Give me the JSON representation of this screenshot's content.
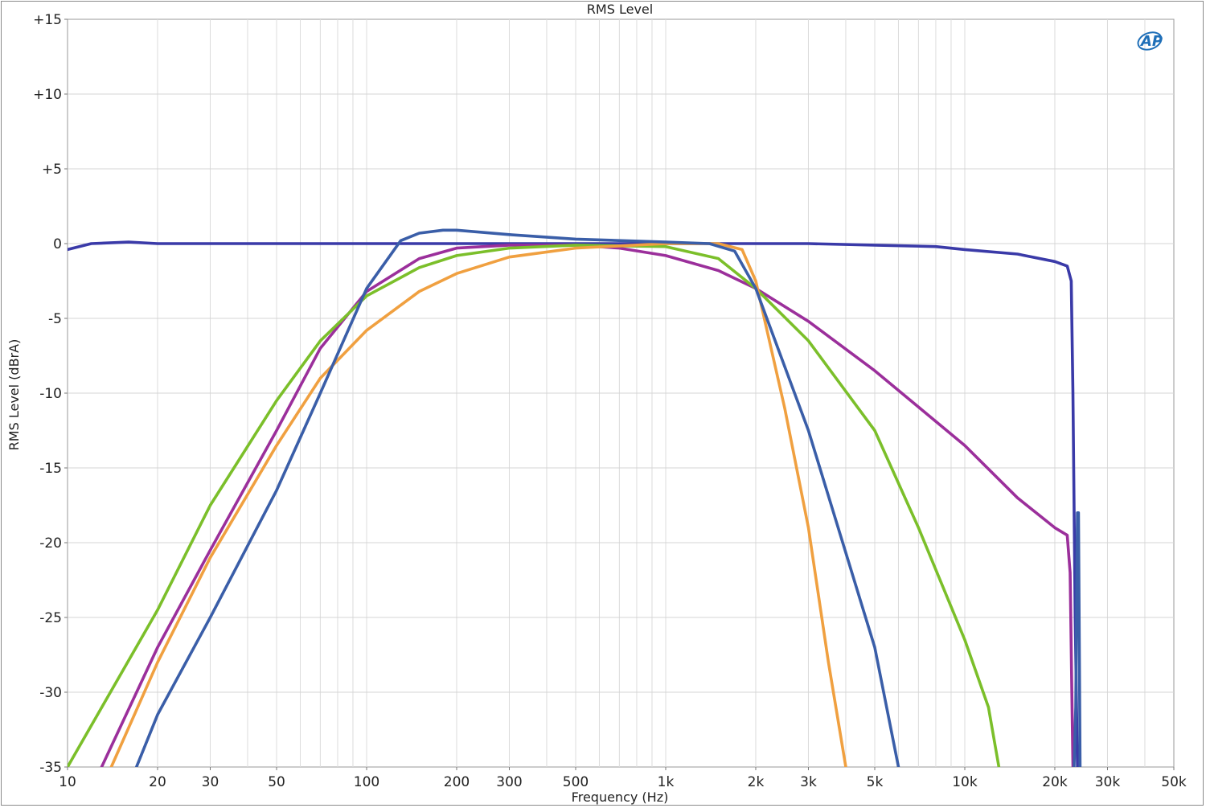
{
  "chart_data": {
    "type": "line",
    "title": "RMS Level",
    "xlabel": "Frequency (Hz)",
    "ylabel": "RMS Level (dBrA)",
    "x_scale": "log",
    "xlim": [
      10,
      50000
    ],
    "ylim": [
      -35,
      15
    ],
    "grid": true,
    "logo": "AP",
    "x_ticks": [
      {
        "v": 10,
        "label": "10"
      },
      {
        "v": 20,
        "label": "20"
      },
      {
        "v": 30,
        "label": "30"
      },
      {
        "v": 50,
        "label": "50"
      },
      {
        "v": 100,
        "label": "100"
      },
      {
        "v": 200,
        "label": "200"
      },
      {
        "v": 300,
        "label": "300"
      },
      {
        "v": 500,
        "label": "500"
      },
      {
        "v": 1000,
        "label": "1k"
      },
      {
        "v": 2000,
        "label": "2k"
      },
      {
        "v": 3000,
        "label": "3k"
      },
      {
        "v": 5000,
        "label": "5k"
      },
      {
        "v": 10000,
        "label": "10k"
      },
      {
        "v": 20000,
        "label": "20k"
      },
      {
        "v": 30000,
        "label": "30k"
      },
      {
        "v": 50000,
        "label": "50k"
      }
    ],
    "y_ticks": [
      {
        "v": 15,
        "label": "+15"
      },
      {
        "v": 10,
        "label": "+10"
      },
      {
        "v": 5,
        "label": "+5"
      },
      {
        "v": 0,
        "label": "0"
      },
      {
        "v": -5,
        "label": "-5"
      },
      {
        "v": -10,
        "label": "-10"
      },
      {
        "v": -15,
        "label": "-15"
      },
      {
        "v": -20,
        "label": "-20"
      },
      {
        "v": -25,
        "label": "-25"
      },
      {
        "v": -30,
        "label": "-30"
      },
      {
        "v": -35,
        "label": "-35"
      }
    ],
    "series": [
      {
        "color": "#3a3aa8",
        "points": [
          [
            10,
            -0.4
          ],
          [
            12,
            0.0
          ],
          [
            16,
            0.1
          ],
          [
            20,
            0.0
          ],
          [
            50,
            0.0
          ],
          [
            100,
            0.0
          ],
          [
            1000,
            0.0
          ],
          [
            3000,
            0.0
          ],
          [
            5000,
            -0.1
          ],
          [
            8000,
            -0.2
          ],
          [
            10000,
            -0.4
          ],
          [
            15000,
            -0.7
          ],
          [
            20000,
            -1.2
          ],
          [
            22000,
            -1.5
          ],
          [
            22700,
            -2.5
          ],
          [
            23000,
            -10
          ],
          [
            23400,
            -25
          ],
          [
            23800,
            -35
          ]
        ]
      },
      {
        "color": "#9b2f9b",
        "points": [
          [
            13,
            -35
          ],
          [
            20,
            -27
          ],
          [
            30,
            -20.5
          ],
          [
            50,
            -12.5
          ],
          [
            70,
            -7
          ],
          [
            100,
            -3.2
          ],
          [
            150,
            -1.0
          ],
          [
            200,
            -0.3
          ],
          [
            300,
            -0.1
          ],
          [
            500,
            -0.1
          ],
          [
            700,
            -0.3
          ],
          [
            1000,
            -0.8
          ],
          [
            1500,
            -1.8
          ],
          [
            2000,
            -3.0
          ],
          [
            3000,
            -5.2
          ],
          [
            5000,
            -8.5
          ],
          [
            10000,
            -13.5
          ],
          [
            15000,
            -17
          ],
          [
            20000,
            -19.0
          ],
          [
            22000,
            -19.5
          ],
          [
            22500,
            -22
          ],
          [
            23000,
            -35
          ]
        ]
      },
      {
        "color": "#7bbf2a",
        "points": [
          [
            10,
            -35
          ],
          [
            20,
            -24.5
          ],
          [
            30,
            -17.5
          ],
          [
            50,
            -10.5
          ],
          [
            70,
            -6.5
          ],
          [
            100,
            -3.5
          ],
          [
            150,
            -1.6
          ],
          [
            200,
            -0.8
          ],
          [
            300,
            -0.3
          ],
          [
            500,
            -0.1
          ],
          [
            1000,
            -0.2
          ],
          [
            1500,
            -1.0
          ],
          [
            2000,
            -3.0
          ],
          [
            3000,
            -6.5
          ],
          [
            5000,
            -12.5
          ],
          [
            7000,
            -19
          ],
          [
            10000,
            -26.5
          ],
          [
            12000,
            -31
          ],
          [
            13000,
            -35
          ]
        ]
      },
      {
        "color": "#f0a040",
        "points": [
          [
            14,
            -35
          ],
          [
            20,
            -28
          ],
          [
            30,
            -21
          ],
          [
            50,
            -13.5
          ],
          [
            70,
            -9
          ],
          [
            100,
            -5.8
          ],
          [
            150,
            -3.2
          ],
          [
            200,
            -2.0
          ],
          [
            300,
            -0.9
          ],
          [
            500,
            -0.3
          ],
          [
            1000,
            0.0
          ],
          [
            1500,
            0.0
          ],
          [
            1800,
            -0.4
          ],
          [
            2000,
            -2.5
          ],
          [
            2500,
            -11
          ],
          [
            3000,
            -19
          ],
          [
            3500,
            -28
          ],
          [
            4000,
            -35
          ]
        ]
      },
      {
        "color": "#3a5ea8",
        "points": [
          [
            17,
            -35
          ],
          [
            20,
            -31.5
          ],
          [
            30,
            -25
          ],
          [
            50,
            -16.5
          ],
          [
            70,
            -10
          ],
          [
            100,
            -3.0
          ],
          [
            130,
            0.2
          ],
          [
            150,
            0.7
          ],
          [
            180,
            0.9
          ],
          [
            200,
            0.9
          ],
          [
            300,
            0.6
          ],
          [
            500,
            0.3
          ],
          [
            1000,
            0.1
          ],
          [
            1400,
            0.0
          ],
          [
            1700,
            -0.5
          ],
          [
            2000,
            -3.0
          ],
          [
            3000,
            -12.5
          ],
          [
            5000,
            -27
          ],
          [
            6000,
            -35
          ]
        ]
      },
      {
        "color": "#3a5ea8",
        "points": [
          [
            23200,
            -35
          ],
          [
            23500,
            -31
          ],
          [
            23800,
            -18
          ],
          [
            24000,
            -18
          ],
          [
            24300,
            -35
          ]
        ]
      }
    ]
  }
}
